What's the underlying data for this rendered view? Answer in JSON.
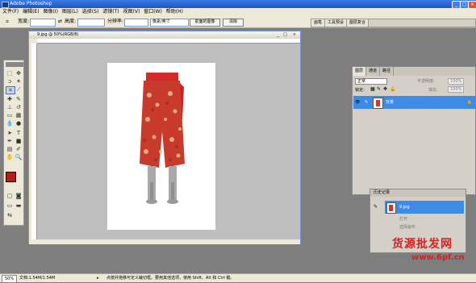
{
  "app": {
    "title": "Adobe Photoshop"
  },
  "menu": [
    "文件(F)",
    "编辑(E)",
    "图像(I)",
    "图层(L)",
    "选择(S)",
    "滤镜(T)",
    "视图(V)",
    "窗口(W)",
    "帮助(H)"
  ],
  "options": {
    "width_label": "宽度:",
    "height_label": "高度:",
    "resolution_label": "分辨率:",
    "unit_value": "像素/英寸",
    "front_image_button": "前面的图像",
    "clear_button": "清除"
  },
  "dock_tabs": [
    "画笔",
    "工具预设",
    "图层复合"
  ],
  "document": {
    "title": "9.jpg @ 50%(RGB/8)"
  },
  "layers_panel": {
    "tabs": [
      "图层",
      "通道",
      "路径"
    ],
    "blend_mode": "正常",
    "opacity_label": "不透明度:",
    "opacity_value": "100%",
    "lock_label": "锁定:",
    "fill_label": "填充:",
    "fill_value": "100%",
    "layer_name": "背景"
  },
  "history_panel": {
    "title": "历史记录",
    "snapshot": "9.jpg",
    "items": [
      "打开",
      "选择画布"
    ]
  },
  "status": {
    "zoom": "50%",
    "doc_info": "文档:1.54M/1.54M",
    "hint": "点按并拖移可定义裁切框。要用其他选项，使用 Shift、Alt 和 Ctrl 键。"
  },
  "watermark": {
    "line1": "货源批发网",
    "line2": "www.6pf.cn"
  },
  "colors": {
    "foreground": "#b0201a",
    "background": "#ffffff",
    "selection": "#3d8be6",
    "title_bar": "#2a66d6"
  }
}
